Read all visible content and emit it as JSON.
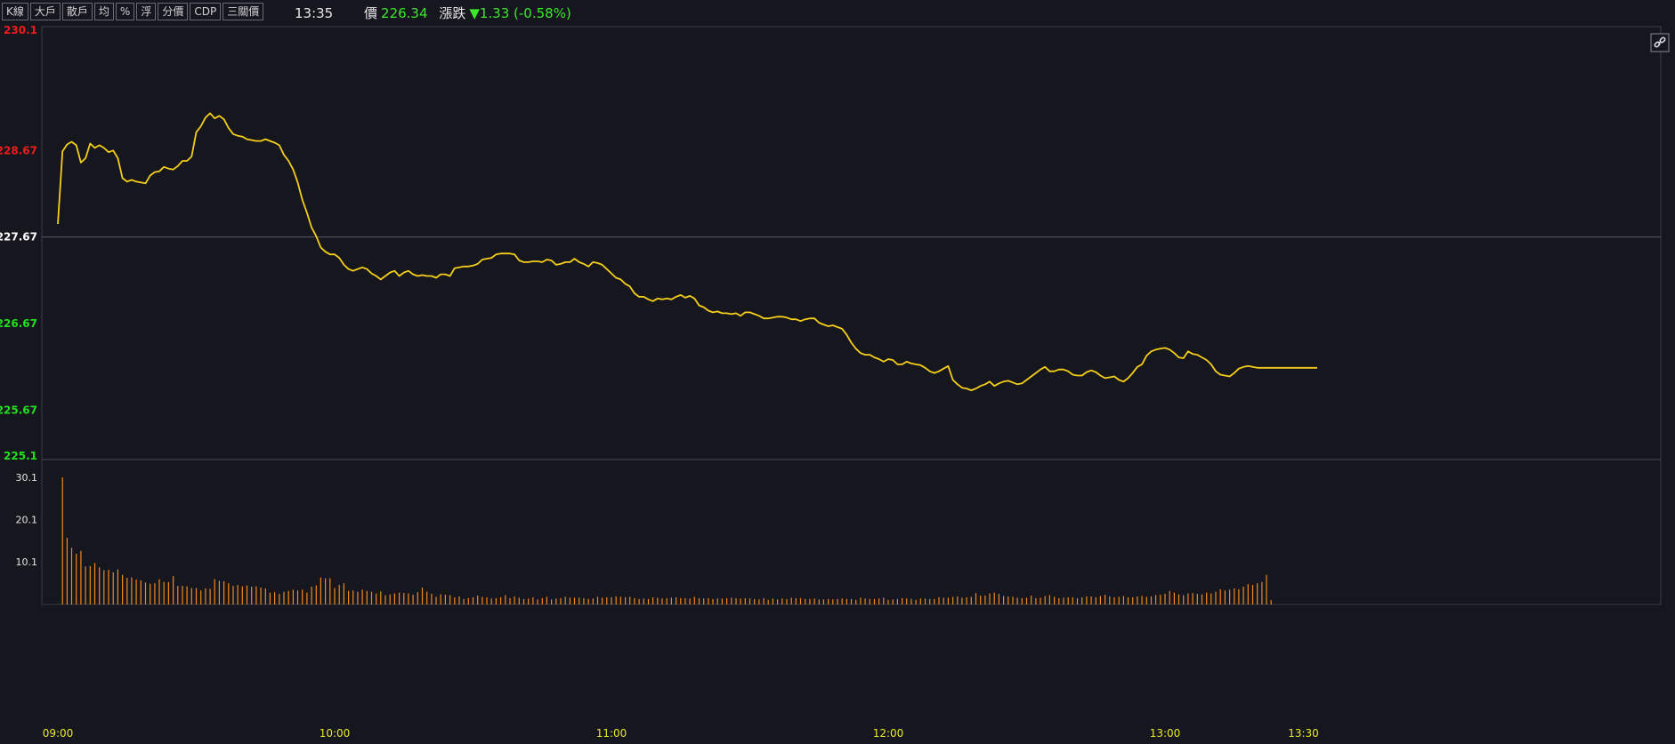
{
  "toolbar": {
    "buttons": [
      "K線",
      "大戶",
      "散戶",
      "均",
      "%",
      "浮",
      "分價",
      "CDP",
      "三關價"
    ]
  },
  "quote": {
    "time": "13:35",
    "price_label": "價",
    "price": "226.34",
    "change_label": "漲跌",
    "change": "▼1.33 (-0.58%)"
  },
  "colors": {
    "background": "#16161e",
    "price_line": "#f5cf1a",
    "volume_bar": "#f08a1e",
    "up": "#ee1c1c",
    "down": "#22e01e",
    "ref": "#ffffff",
    "time_axis": "#e8e82a"
  },
  "icons": {
    "link": "link-icon"
  },
  "chart_data": {
    "type": "line",
    "reference_price": 227.67,
    "price_ylim": [
      225.1,
      230.1
    ],
    "price_ticks": [
      {
        "label": "230.1",
        "value": 230.1,
        "kind": "up"
      },
      {
        "label": "228.67",
        "value": 228.67,
        "kind": "up"
      },
      {
        "label": "227.67",
        "value": 227.67,
        "kind": "ref"
      },
      {
        "label": "226.67",
        "value": 226.67,
        "kind": "down"
      },
      {
        "label": "225.67",
        "value": 225.67,
        "kind": "down"
      },
      {
        "label": "225.1",
        "value": 225.1,
        "kind": "down"
      }
    ],
    "x_ticks": [
      "09:00",
      "10:00",
      "11:00",
      "12:00",
      "13:00",
      "13:30"
    ],
    "x_tick_minutes": [
      0,
      60,
      120,
      180,
      240,
      270
    ],
    "price_series": {
      "minutes": [
        0,
        1,
        2,
        3,
        4,
        5,
        6,
        7,
        8,
        9,
        10,
        11,
        12,
        13,
        14,
        15,
        16,
        17,
        18,
        19,
        20,
        21,
        22,
        23,
        24,
        25,
        26,
        27,
        28,
        29,
        30,
        31,
        32,
        33,
        34,
        35,
        36,
        37,
        38,
        39,
        40,
        41,
        42,
        43,
        44,
        45,
        46,
        47,
        48,
        49,
        50,
        51,
        52,
        53,
        54,
        55,
        56,
        57,
        58,
        59,
        60,
        61,
        62,
        63,
        64,
        65,
        66,
        67,
        68,
        69,
        70,
        71,
        72,
        73,
        74,
        75,
        76,
        77,
        78,
        79,
        80,
        81,
        82,
        83,
        84,
        85,
        86,
        87,
        88,
        89,
        90,
        91,
        92,
        93,
        94,
        95,
        96,
        97,
        98,
        99,
        100,
        101,
        102,
        103,
        104,
        105,
        106,
        107,
        108,
        109,
        110,
        111,
        112,
        113,
        114,
        115,
        116,
        117,
        118,
        119,
        120,
        121,
        122,
        123,
        124,
        125,
        126,
        127,
        128,
        129,
        130,
        131,
        132,
        133,
        134,
        135,
        136,
        137,
        138,
        139,
        140,
        141,
        142,
        143,
        144,
        145,
        146,
        147,
        148,
        149,
        150,
        151,
        152,
        153,
        154,
        155,
        156,
        157,
        158,
        159,
        160,
        161,
        162,
        163,
        164,
        165,
        166,
        167,
        168,
        169,
        170,
        171,
        172,
        173,
        174,
        175,
        176,
        177,
        178,
        179,
        180,
        181,
        182,
        183,
        184,
        185,
        186,
        187,
        188,
        189,
        190,
        191,
        192,
        193,
        194,
        195,
        196,
        197,
        198,
        199,
        200,
        201,
        202,
        203,
        204,
        205,
        206,
        207,
        208,
        209,
        210,
        211,
        212,
        213,
        214,
        215,
        216,
        217,
        218,
        219,
        220,
        221,
        222,
        223,
        224,
        225,
        226,
        227,
        228,
        229,
        230,
        231,
        232,
        233,
        234,
        235,
        236,
        237,
        238,
        239,
        240,
        241,
        242,
        243,
        244,
        245,
        246,
        247,
        248,
        249,
        250,
        251,
        252,
        253,
        254,
        255,
        256,
        257,
        258,
        259,
        260,
        261,
        262,
        263,
        264,
        265,
        266,
        267,
        268,
        269,
        270,
        271,
        272,
        273,
        274,
        275,
        276,
        277,
        278,
        279,
        280,
        281,
        282,
        283,
        284
      ],
      "values": [
        227.82,
        228.66,
        228.74,
        228.77,
        228.73,
        228.53,
        228.58,
        228.75,
        228.7,
        228.73,
        228.7,
        228.65,
        228.67,
        228.58,
        228.35,
        228.31,
        228.33,
        228.31,
        228.3,
        228.29,
        228.38,
        228.42,
        228.43,
        228.48,
        228.46,
        228.45,
        228.49,
        228.55,
        228.55,
        228.6,
        228.88,
        228.95,
        229.05,
        229.1,
        229.04,
        229.07,
        229.03,
        228.93,
        228.86,
        228.84,
        228.83,
        228.8,
        228.79,
        228.78,
        228.78,
        228.8,
        228.78,
        228.76,
        228.73,
        228.62,
        228.55,
        228.45,
        228.3,
        228.1,
        227.95,
        227.78,
        227.68,
        227.55,
        227.5,
        227.47,
        227.47,
        227.43,
        227.35,
        227.3,
        227.28,
        227.3,
        227.32,
        227.3,
        227.25,
        227.22,
        227.18,
        227.22,
        227.26,
        227.28,
        227.22,
        227.26,
        227.28,
        227.24,
        227.22,
        227.23,
        227.22,
        227.22,
        227.2,
        227.24,
        227.24,
        227.22,
        227.31,
        227.32,
        227.33,
        227.33,
        227.34,
        227.36,
        227.41,
        227.42,
        227.43,
        227.47,
        227.48,
        227.48,
        227.48,
        227.47,
        227.4,
        227.38,
        227.38,
        227.39,
        227.39,
        227.38,
        227.41,
        227.4,
        227.35,
        227.36,
        227.38,
        227.38,
        227.42,
        227.38,
        227.36,
        227.33,
        227.38,
        227.37,
        227.35,
        227.3,
        227.25,
        227.2,
        227.18,
        227.13,
        227.1,
        227.02,
        226.98,
        226.98,
        226.95,
        226.93,
        226.96,
        226.95,
        226.96,
        226.95,
        226.98,
        227.0,
        226.97,
        226.99,
        226.96,
        226.88,
        226.86,
        226.82,
        226.8,
        226.81,
        226.79,
        226.79,
        226.78,
        226.79,
        226.76,
        226.8,
        226.8,
        226.78,
        226.76,
        226.73,
        226.73,
        226.74,
        226.75,
        226.75,
        226.74,
        226.72,
        226.72,
        226.7,
        226.72,
        226.73,
        226.73,
        226.68,
        226.66,
        226.64,
        226.65,
        226.63,
        226.61,
        226.54,
        226.45,
        226.38,
        226.33,
        226.31,
        226.31,
        226.28,
        226.26,
        226.23,
        226.26,
        226.25,
        226.2,
        226.2,
        226.23,
        226.21,
        226.2,
        226.19,
        226.16,
        226.12,
        226.1,
        226.12,
        226.15,
        226.18,
        226.02,
        225.97,
        225.93,
        225.92,
        225.9,
        225.92,
        225.95,
        225.97,
        226.0,
        225.95,
        225.98,
        226.0,
        226.01,
        225.99,
        225.97,
        225.98,
        226.02,
        226.06,
        226.1,
        226.14,
        226.17,
        226.12,
        226.12,
        226.14,
        226.14,
        226.12,
        226.08,
        226.07,
        226.07,
        226.11,
        226.13,
        226.11,
        226.07,
        226.04,
        226.05,
        226.06,
        226.02,
        226.0,
        226.04,
        226.1,
        226.17,
        226.2,
        226.3,
        226.35,
        226.37,
        226.38,
        226.39,
        226.37,
        226.33,
        226.28,
        226.27,
        226.35,
        226.32,
        226.31,
        226.28,
        226.25,
        226.2,
        226.12,
        226.08,
        226.07,
        226.06,
        226.1,
        226.15,
        226.17,
        226.18,
        226.17,
        226.16,
        226.16,
        226.16,
        226.16,
        226.16,
        226.16,
        226.16,
        226.16,
        226.16,
        226.16,
        226.16,
        226.16,
        226.16,
        226.16
      ]
    },
    "volume_ylim": [
      0,
      30.1
    ],
    "volume_ticks": [
      {
        "label": "30.1",
        "value": 30.1
      },
      {
        "label": "20.1",
        "value": 20.1
      },
      {
        "label": "10.1",
        "value": 10.1
      }
    ],
    "volume_series": {
      "values": [
        30.1,
        15.8,
        13.4,
        12.0,
        12.7,
        9.0,
        9.1,
        9.8,
        8.8,
        8.1,
        8.2,
        7.6,
        8.3,
        7.0,
        6.3,
        6.4,
        5.9,
        5.7,
        5.2,
        4.9,
        5.0,
        6.0,
        5.3,
        5.3,
        6.7,
        4.4,
        4.4,
        4.3,
        3.9,
        3.9,
        3.3,
        3.8,
        3.7,
        6.0,
        5.6,
        5.5,
        5.0,
        4.4,
        4.6,
        4.3,
        4.5,
        4.2,
        4.3,
        4.0,
        3.8,
        2.8,
        2.9,
        2.5,
        3.0,
        3.2,
        3.5,
        3.3,
        3.5,
        2.8,
        4.2,
        4.5,
        6.4,
        6.2,
        6.2,
        3.9,
        4.6,
        5.0,
        3.2,
        3.3,
        3.0,
        3.5,
        3.2,
        3.0,
        2.6,
        3.1,
        2.2,
        2.4,
        2.6,
        2.8,
        2.7,
        2.6,
        2.3,
        2.9,
        4.0,
        3.0,
        2.5,
        1.8,
        2.4,
        2.3,
        2.2,
        1.7,
        1.9,
        1.3,
        1.5,
        1.7,
        2.1,
        1.8,
        1.7,
        1.4,
        1.5,
        1.7,
        2.2,
        1.5,
        1.9,
        1.6,
        1.3,
        1.4,
        1.7,
        1.2,
        1.5,
        1.8,
        1.2,
        1.4,
        1.5,
        1.8,
        1.6,
        1.6,
        1.6,
        1.5,
        1.3,
        1.4,
        1.8,
        1.6,
        1.7,
        1.7,
        1.9,
        1.8,
        1.7,
        1.8,
        1.5,
        1.3,
        1.4,
        1.3,
        1.7,
        1.6,
        1.4,
        1.5,
        1.6,
        1.7,
        1.5,
        1.5,
        1.4,
        1.8,
        1.5,
        1.4,
        1.5,
        1.3,
        1.4,
        1.4,
        1.5,
        1.6,
        1.5,
        1.4,
        1.5,
        1.4,
        1.3,
        1.2,
        1.5,
        1.1,
        1.4,
        1.2,
        1.4,
        1.3,
        1.6,
        1.5,
        1.5,
        1.3,
        1.3,
        1.4,
        1.2,
        1.2,
        1.3,
        1.2,
        1.3,
        1.4,
        1.3,
        1.3,
        1.1,
        1.6,
        1.4,
        1.3,
        1.3,
        1.4,
        1.6,
        1.1,
        1.2,
        1.3,
        1.5,
        1.4,
        1.3,
        1.1,
        1.4,
        1.4,
        1.3,
        1.3,
        1.7,
        1.6,
        1.6,
        1.8,
        1.9,
        1.6,
        1.7,
        1.8,
        2.7,
        2.1,
        2.1,
        2.6,
        2.8,
        2.5,
        2.0,
        1.9,
        1.8,
        1.6,
        1.5,
        1.6,
        2.1,
        1.5,
        1.6,
        2.0,
        2.2,
        1.8,
        1.5,
        1.6,
        1.7,
        1.7,
        1.5,
        1.7,
        1.9,
        1.9,
        1.7,
        2.0,
        2.3,
        1.9,
        1.7,
        1.8,
        2.0,
        1.7,
        1.7,
        1.9,
        2.0,
        1.8,
        1.9,
        2.2,
        2.3,
        2.5,
        3.2,
        2.8,
        2.4,
        2.2,
        2.6,
        2.7,
        2.5,
        2.4,
        2.8,
        2.6,
        3.0,
        3.6,
        3.3,
        3.5,
        3.8,
        3.6,
        4.2,
        4.8,
        4.6,
        5.0,
        5.3,
        7.0,
        1.0
      ]
    }
  }
}
